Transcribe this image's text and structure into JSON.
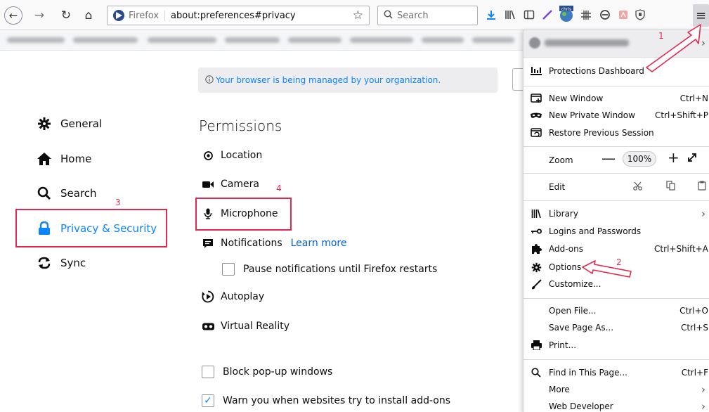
{
  "toolbar": {
    "back_icon": "←",
    "forward_icon": "→",
    "reload_icon": "↻",
    "home_icon": "⌂",
    "identity_label": "Firefox",
    "url": "about:preferences#privacy",
    "star_icon": "☆",
    "search_placeholder": "Search",
    "menu_icon": "≡"
  },
  "sidebar": {
    "items": [
      {
        "label": "General",
        "icon": "gear-icon"
      },
      {
        "label": "Home",
        "icon": "home-icon"
      },
      {
        "label": "Search",
        "icon": "search-icon"
      },
      {
        "label": "Privacy & Security",
        "icon": "lock-icon",
        "active": true
      },
      {
        "label": "Sync",
        "icon": "sync-icon"
      }
    ]
  },
  "content": {
    "managed_banner": "Your browser is being managed by your organization.",
    "section_title": "Permissions",
    "permissions": {
      "location": "Location",
      "camera": "Camera",
      "microphone": "Microphone",
      "notifications": "Notifications",
      "learn_more": "Learn more",
      "pause_notifications": "Pause notifications until Firefox restarts",
      "autoplay": "Autoplay",
      "virtual_reality": "Virtual Reality"
    },
    "block_popups": {
      "label": "Block pop-up windows",
      "checked": false
    },
    "warn_addons": {
      "label": "Warn you when websites try to install add-ons",
      "checked": true
    }
  },
  "menu": {
    "protections_dashboard": "Protections Dashboard",
    "new_window": {
      "label": "New Window",
      "shortcut": "Ctrl+N"
    },
    "new_private_window": {
      "label": "New Private Window",
      "shortcut": "Ctrl+Shift+P"
    },
    "restore_session": "Restore Previous Session",
    "zoom_label": "Zoom",
    "zoom_value": "100%",
    "zoom_minus": "—",
    "zoom_plus": "+",
    "edit_label": "Edit",
    "library": "Library",
    "logins_passwords": "Logins and Passwords",
    "addons": {
      "label": "Add-ons",
      "shortcut": "Ctrl+Shift+A"
    },
    "options": "Options",
    "customize": "Customize...",
    "open_file": {
      "label": "Open File...",
      "shortcut": "Ctrl+O"
    },
    "save_page": {
      "label": "Save Page As...",
      "shortcut": "Ctrl+S"
    },
    "print": "Print...",
    "find_in_page": {
      "label": "Find in This Page...",
      "shortcut": "Ctrl+F"
    },
    "more": "More",
    "web_developer": "Web Developer"
  },
  "annotations": [
    "1",
    "2",
    "3",
    "4"
  ],
  "colors": {
    "accent": "#0a84ff",
    "annotation_red": "#e22850",
    "link": "#0060df"
  }
}
